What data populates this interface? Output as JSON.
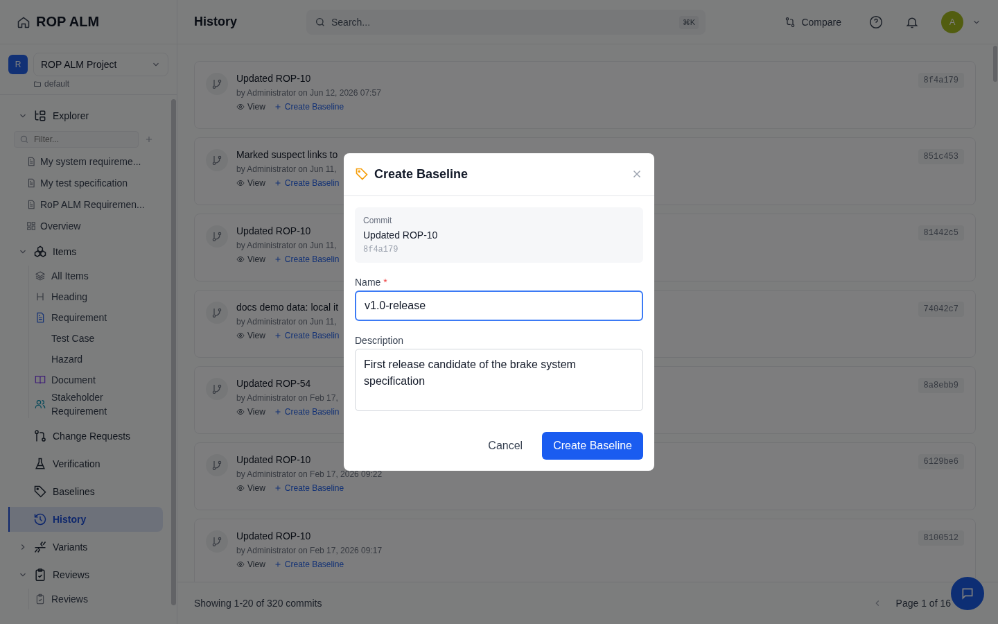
{
  "sidebar": {
    "brand": "ROP ALM",
    "project": {
      "badge": "R",
      "name": "ROP ALM Project",
      "workspace": "default"
    },
    "filter": {
      "placeholder": "Filter..."
    },
    "nav": [
      {
        "label": "Explorer",
        "kind": "explorer",
        "expanded": true,
        "selected": false,
        "children": [
          {
            "label": "My system requireme...",
            "kind": "file",
            "selected": false
          },
          {
            "label": "My test specification",
            "kind": "file",
            "selected": false
          },
          {
            "label": "RoP ALM Requiremen...",
            "kind": "file",
            "selected": false
          },
          {
            "label": "Overview",
            "kind": "overview",
            "selected": false
          }
        ]
      },
      {
        "label": "Items",
        "kind": "items",
        "expanded": true,
        "selected": false,
        "children": [
          {
            "label": "All Items",
            "kind": "layers",
            "selected": false
          },
          {
            "label": "Heading",
            "kind": "heading",
            "selected": false
          },
          {
            "label": "Requirement",
            "kind": "requirement",
            "selected": false
          },
          {
            "label": "Test Case",
            "kind": "plain",
            "selected": false
          },
          {
            "label": "Hazard",
            "kind": "plain",
            "selected": false
          },
          {
            "label": "Document",
            "kind": "book",
            "selected": false
          },
          {
            "label": "Stakeholder Requirement",
            "kind": "people",
            "selected": false
          }
        ]
      },
      {
        "label": "Change Requests",
        "kind": "change",
        "selected": false
      },
      {
        "label": "Verification",
        "kind": "flask",
        "selected": false
      },
      {
        "label": "Baselines",
        "kind": "tag",
        "selected": false
      },
      {
        "label": "History",
        "kind": "history",
        "selected": true
      },
      {
        "label": "Variants",
        "kind": "variants",
        "expanded": false,
        "selected": false
      },
      {
        "label": "Reviews",
        "kind": "reviews",
        "expanded": true,
        "selected": false,
        "children": [
          {
            "label": "Reviews",
            "kind": "clipboard",
            "selected": false
          }
        ]
      }
    ]
  },
  "header": {
    "title": "History",
    "search": {
      "placeholder": "Search...",
      "shortcut": "⌘K"
    },
    "compare": "Compare",
    "avatar": "A"
  },
  "commits": [
    {
      "title": "Updated ROP-10",
      "meta": "by Administrator on Jun 12, 2026 07:57",
      "view": "View",
      "action": "Create Baseline",
      "hash": "8f4a179"
    },
    {
      "title": "Marked suspect links to",
      "meta": "by Administrator on Jun 11,",
      "view": "View",
      "action": "Create Baselin",
      "hash": "851c453"
    },
    {
      "title": "Updated ROP-10",
      "meta": "by Administrator on Jun 11,",
      "view": "View",
      "action": "Create Baselin",
      "hash": "81442c5"
    },
    {
      "title": "docs demo data: local it",
      "meta": "by Administrator on Jun 11,",
      "view": "View",
      "action": "Create Baselin",
      "hash": "74042c7"
    },
    {
      "title": "Updated ROP-54",
      "meta": "by Administrator on Feb 17,",
      "view": "View",
      "action": "Create Baselin",
      "hash": "8a8ebb9"
    },
    {
      "title": "Updated ROP-10",
      "meta": "by Administrator on Feb 17, 2026 09:22",
      "view": "View",
      "action": "Create Baseline",
      "hash": "6129be6"
    },
    {
      "title": "Updated ROP-10",
      "meta": "by Administrator on Feb 17, 2026 09:17",
      "view": "View",
      "action": "Create Baseline",
      "hash": "8100512"
    }
  ],
  "footer": {
    "summary": "Showing 1-20 of 320 commits",
    "page": "Page 1 of 16"
  },
  "dialog": {
    "title": "Create Baseline",
    "commit": {
      "label": "Commit",
      "title": "Updated ROP-10",
      "hash": "8f4a179"
    },
    "name": {
      "label": "Name",
      "required": "*",
      "value": "v1.0-release"
    },
    "description": {
      "label": "Description",
      "value": "First release candidate of the brake system specification"
    },
    "buttons": {
      "cancel": "Cancel",
      "confirm": "Create Baseline"
    }
  }
}
